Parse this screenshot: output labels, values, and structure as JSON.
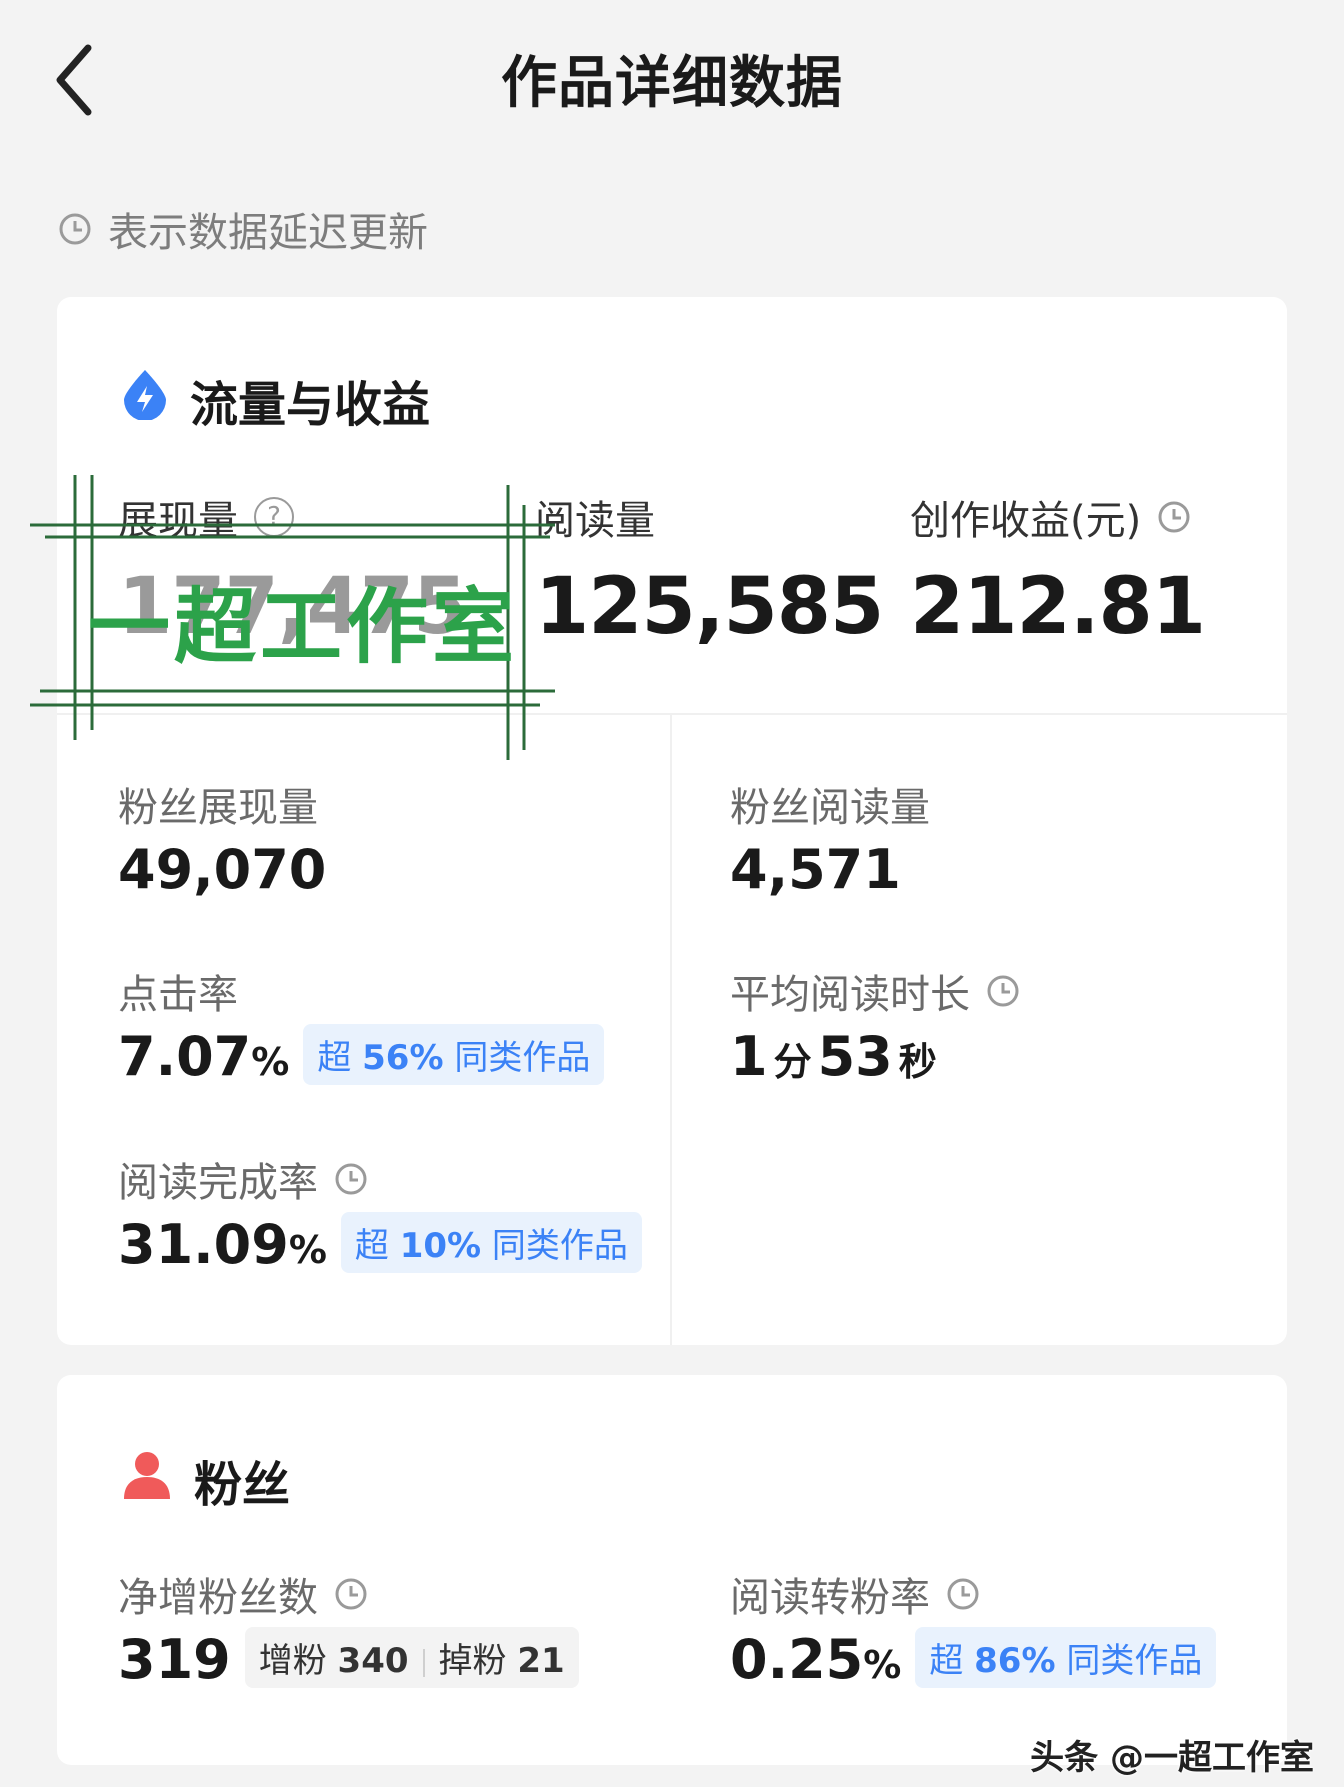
{
  "header": {
    "title": "作品详细数据"
  },
  "notice": {
    "text": "表示数据延迟更新"
  },
  "traffic": {
    "title": "流量与收益",
    "impressions": {
      "label": "展现量",
      "value": "177,475"
    },
    "reads": {
      "label": "阅读量",
      "value": "125,585"
    },
    "revenue": {
      "label": "创作收益(元)",
      "value": "212.81"
    },
    "fan_impressions": {
      "label": "粉丝展现量",
      "value": "49,070"
    },
    "fan_reads": {
      "label": "粉丝阅读量",
      "value": "4,571"
    },
    "ctr": {
      "label": "点击率",
      "value": "7.07",
      "unit": "%",
      "badge_prefix": "超",
      "badge_pct": "56%",
      "badge_suffix": "同类作品"
    },
    "avg_time": {
      "label": "平均阅读时长",
      "minutes": "1",
      "min_unit": "分",
      "seconds": "53",
      "sec_unit": "秒"
    },
    "completion": {
      "label": "阅读完成率",
      "value": "31.09",
      "unit": "%",
      "badge_prefix": "超",
      "badge_pct": "10%",
      "badge_suffix": "同类作品"
    }
  },
  "fans": {
    "title": "粉丝",
    "net_gain": {
      "label": "净增粉丝数",
      "value": "319",
      "gain_label": "增粉",
      "gain_value": "340",
      "loss_label": "掉粉",
      "loss_value": "21"
    },
    "conversion": {
      "label": "阅读转粉率",
      "value": "0.25",
      "unit": "%",
      "badge_prefix": "超",
      "badge_pct": "86%",
      "badge_suffix": "同类作品"
    }
  },
  "watermark": {
    "text": "一超工作室",
    "footer": "头条 @一超工作室"
  },
  "colors": {
    "accent_blue": "#3b82f6",
    "fan_red": "#f05a5a",
    "watermark_green": "#2ca24a"
  },
  "icons": {
    "back": "chevron-left-icon",
    "clock": "clock-icon",
    "help": "question-circle-icon",
    "traffic": "lightning-drop-icon",
    "fans": "person-icon"
  }
}
